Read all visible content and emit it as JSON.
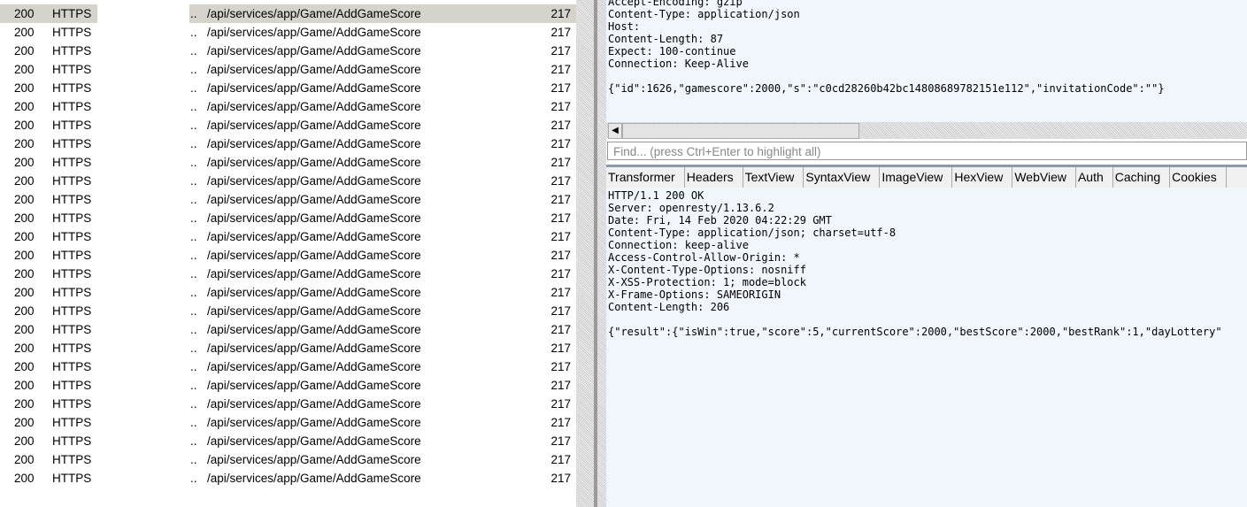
{
  "sessions": {
    "count": 26,
    "row": {
      "result": "200",
      "protocol": "HTTPS",
      "host_suffix": "..",
      "url": "/api/services/app/Game/AddGameScore",
      "body": "217"
    }
  },
  "request": {
    "lines": [
      "Accept-Encoding: gzip",
      "Content-Type: application/json",
      "Host: ",
      "Content-Length: 87",
      "Expect: 100-continue",
      "Connection: Keep-Alive",
      "",
      "{\"id\":1626,\"gamescore\":2000,\"s\":\"c0cd28260b42bc14808689782151e112\",\"invitationCode\":\"\"}"
    ]
  },
  "find": {
    "placeholder": "Find... (press Ctrl+Enter to highlight all)"
  },
  "tabs": [
    "Transformer",
    "Headers",
    "TextView",
    "SyntaxView",
    "ImageView",
    "HexView",
    "WebView",
    "Auth",
    "Caching",
    "Cookies"
  ],
  "response": {
    "lines": [
      "HTTP/1.1 200 OK",
      "Server: openresty/1.13.6.2",
      "Date: Fri, 14 Feb 2020 04:22:29 GMT",
      "Content-Type: application/json; charset=utf-8",
      "Connection: keep-alive",
      "Access-Control-Allow-Origin: *",
      "X-Content-Type-Options: nosniff",
      "X-XSS-Protection: 1; mode=block",
      "X-Frame-Options: SAMEORIGIN",
      "Content-Length: 206",
      "",
      "{\"result\":{\"isWin\":true,\"score\":5,\"currentScore\":2000,\"bestScore\":2000,\"bestRank\":1,\"dayLottery\""
    ]
  }
}
